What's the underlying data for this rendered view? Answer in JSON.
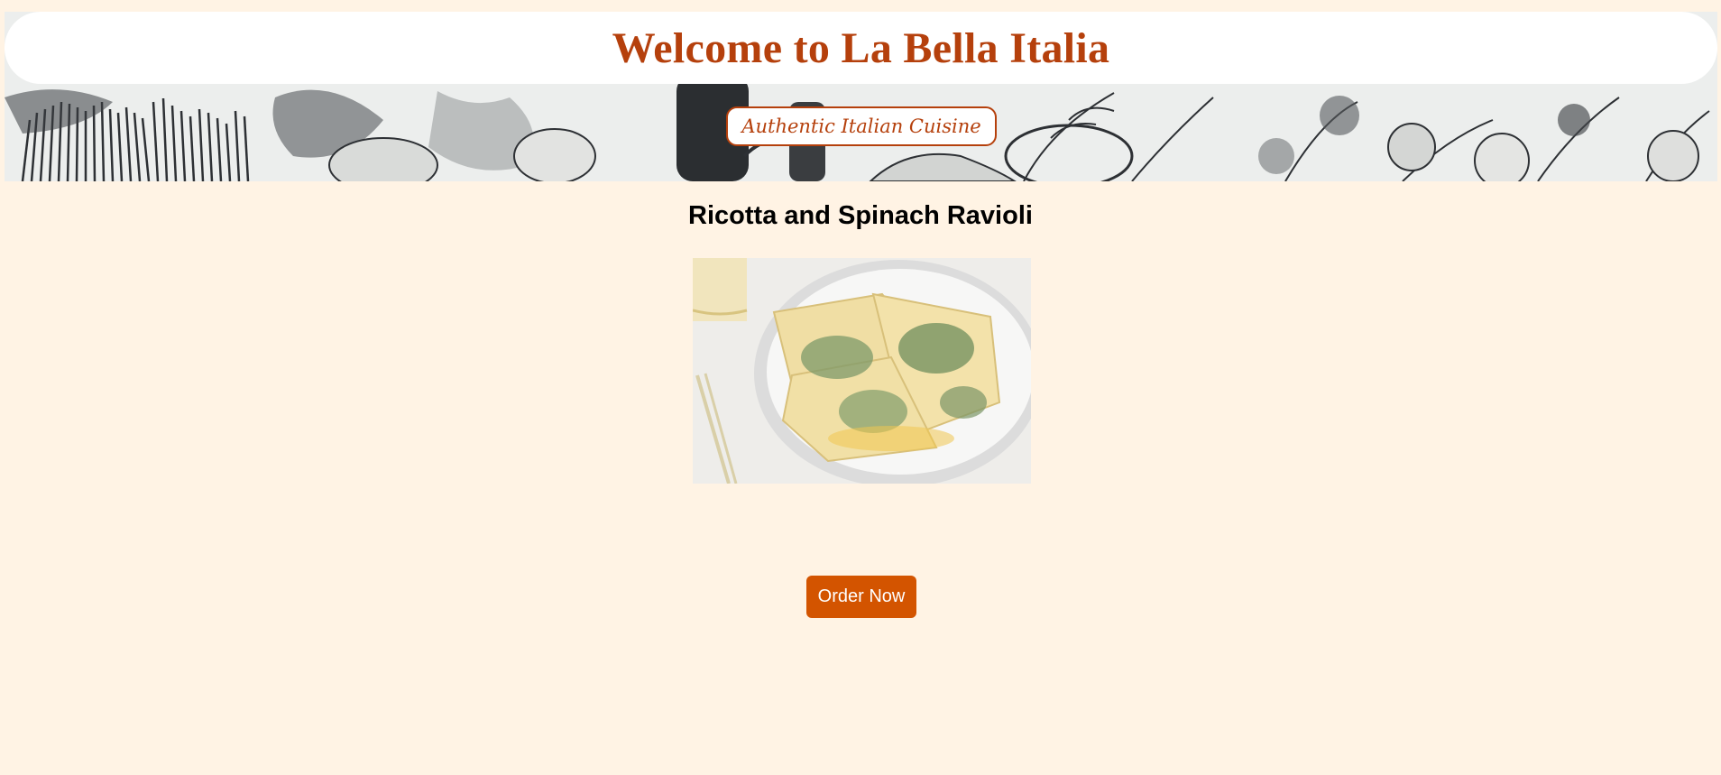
{
  "header": {
    "title": "Welcome to La Bella Italia",
    "tagline": "Authentic Italian Cuisine"
  },
  "dish": {
    "name": "Ricotta and Spinach Ravioli"
  },
  "actions": {
    "order_label": "Order Now"
  },
  "colors": {
    "page_background": "#fff3e4",
    "brand": "#b5400c",
    "button": "#d35400"
  }
}
